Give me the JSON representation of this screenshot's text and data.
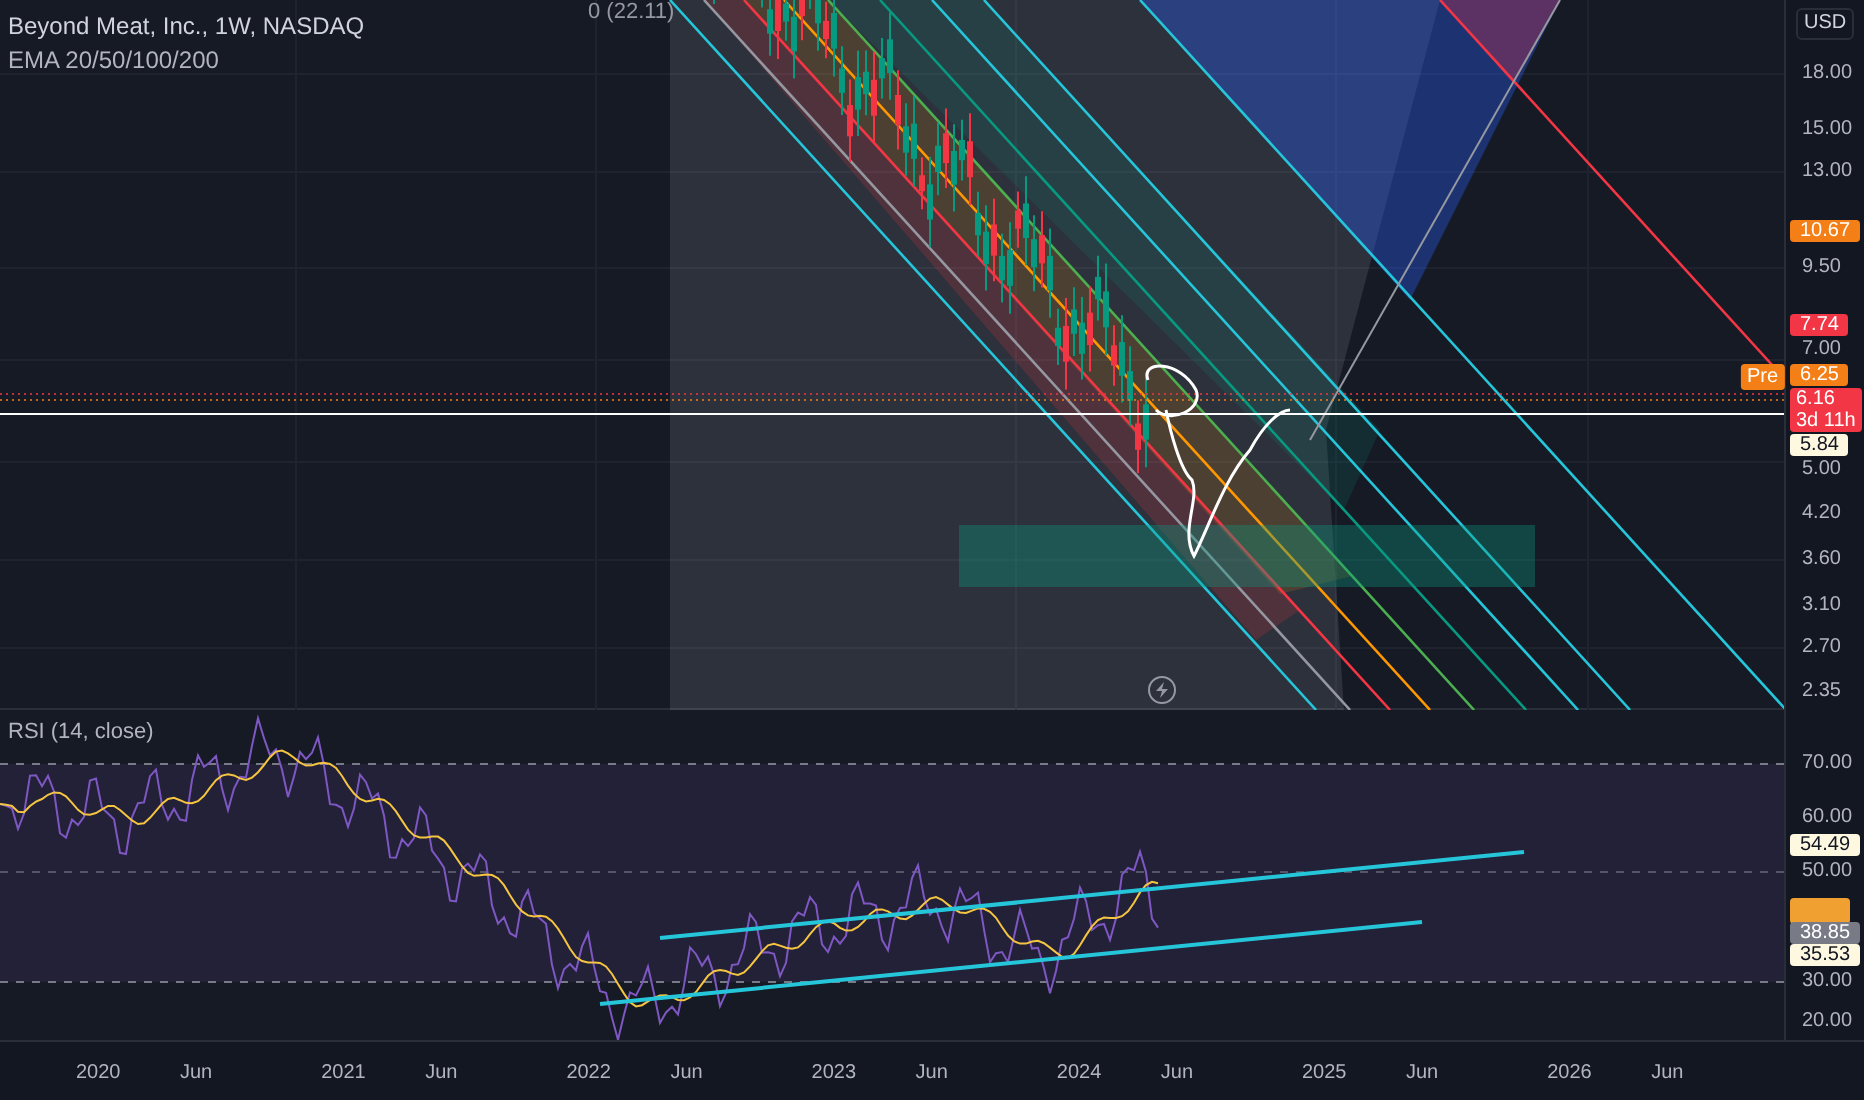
{
  "legend": {
    "title": "Beyond Meat, Inc., 1W, NASDAQ",
    "indicator": "EMA 20/50/100/200"
  },
  "fib_label": "0 (22.11)",
  "currency": "USD",
  "price_axis": [
    {
      "kind": "plain",
      "label": "18.00"
    },
    {
      "kind": "plain",
      "label": "15.00"
    },
    {
      "kind": "plain",
      "label": "13.00"
    },
    {
      "kind": "tag",
      "label": "10.67",
      "color": "#f57f17"
    },
    {
      "kind": "plain",
      "label": "9.50"
    },
    {
      "kind": "tag",
      "label": "7.74",
      "color": "#f23645"
    },
    {
      "kind": "plain",
      "label": "7.00"
    },
    {
      "kind": "pre",
      "badge": "Pre",
      "label": "6.25",
      "color": "#f57f17"
    },
    {
      "kind": "countdown",
      "label": "6.16",
      "sub": "3d 11h",
      "color": "#f23645"
    },
    {
      "kind": "tag",
      "label": "5.84",
      "color": "#fff8e1"
    },
    {
      "kind": "plain",
      "label": "5.00"
    },
    {
      "kind": "plain",
      "label": "4.20"
    },
    {
      "kind": "plain",
      "label": "3.60"
    },
    {
      "kind": "plain",
      "label": "3.10"
    },
    {
      "kind": "plain",
      "label": "2.70"
    },
    {
      "kind": "plain",
      "label": "2.35"
    }
  ],
  "rsi": {
    "title": "RSI (14, close)",
    "axis": [
      {
        "kind": "plain",
        "label": "70.00"
      },
      {
        "kind": "plain",
        "label": "60.00"
      },
      {
        "kind": "tag",
        "label": "54.49",
        "color": "#fff8e1"
      },
      {
        "kind": "plain",
        "label": "50.00"
      },
      {
        "kind": "blank_tag",
        "color": "#f0a030"
      },
      {
        "kind": "tag",
        "label": "38.85",
        "color": "#787b86"
      },
      {
        "kind": "tag",
        "label": "35.53",
        "color": "#fff8e1"
      },
      {
        "kind": "plain",
        "label": "30.00"
      },
      {
        "kind": "plain",
        "label": "20.00"
      }
    ]
  },
  "time_axis": [
    "2020",
    "Jun",
    "2021",
    "Jun",
    "2022",
    "Jun",
    "2023",
    "Jun",
    "2024",
    "Jun",
    "2025",
    "Jun",
    "2026",
    "Jun"
  ]
}
